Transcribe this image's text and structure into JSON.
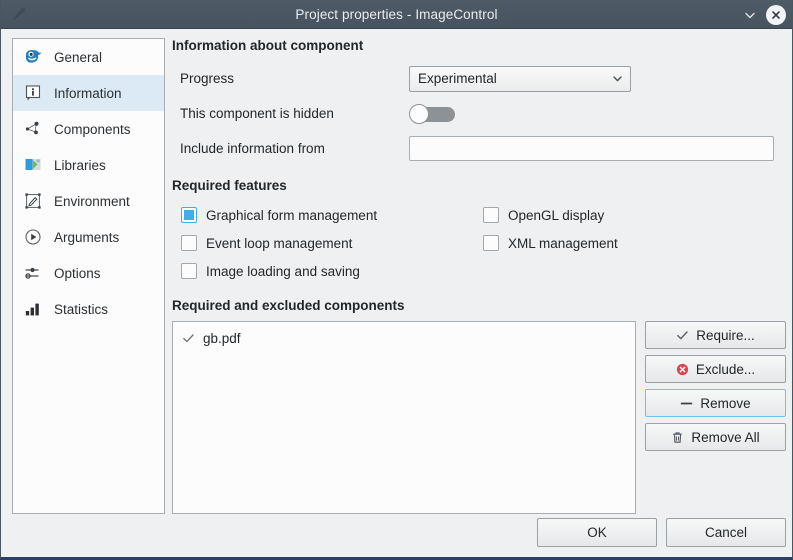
{
  "window": {
    "title": "Project properties - ImageControl",
    "app_icon": "gambas-app-icon",
    "shade_icon": "chevron-down-icon",
    "close_icon": "close-icon"
  },
  "sidebar": {
    "items": [
      {
        "label": "General",
        "icon": "smiley-face-icon",
        "selected": false
      },
      {
        "label": "Information",
        "icon": "info-bubble-icon",
        "selected": true
      },
      {
        "label": "Components",
        "icon": "nodes-network-icon",
        "selected": false
      },
      {
        "label": "Libraries",
        "icon": "library-folder-icon",
        "selected": false
      },
      {
        "label": "Environment",
        "icon": "edit-frame-icon",
        "selected": false
      },
      {
        "label": "Arguments",
        "icon": "play-circle-icon",
        "selected": false
      },
      {
        "label": "Options",
        "icon": "sliders-icon",
        "selected": false
      },
      {
        "label": "Statistics",
        "icon": "bar-chart-icon",
        "selected": false
      }
    ]
  },
  "main": {
    "info_group": {
      "title": "Information about component",
      "progress_label": "Progress",
      "progress_value": "Experimental",
      "progress_chevron": "chevron-down-icon",
      "hidden_label": "This component is hidden",
      "hidden_value": "off",
      "include_label": "Include information from",
      "include_value": "",
      "include_placeholder": ""
    },
    "features_group": {
      "title": "Required features",
      "items": [
        {
          "label": "Graphical form management",
          "checked": true,
          "column": "left"
        },
        {
          "label": "Event loop management",
          "checked": false,
          "column": "left"
        },
        {
          "label": "Image loading and saving",
          "checked": false,
          "column": "left"
        },
        {
          "label": "OpenGL display",
          "checked": false,
          "column": "right"
        },
        {
          "label": "XML management",
          "checked": false,
          "column": "right"
        }
      ]
    },
    "components_group": {
      "title": "Required and excluded components",
      "list_items": [
        {
          "label": "gb.pdf",
          "icon": "check-mark-icon",
          "state": "required"
        }
      ],
      "buttons": [
        {
          "label": "Require...",
          "icon": "check-mark-icon",
          "focused": false
        },
        {
          "label": "Exclude...",
          "icon": "error-circle-icon",
          "focused": false
        },
        {
          "label": "Remove",
          "icon": "minus-icon",
          "focused": true
        },
        {
          "label": "Remove All",
          "icon": "trash-icon",
          "focused": false
        }
      ]
    }
  },
  "footer": {
    "buttons": [
      {
        "label": "OK"
      },
      {
        "label": "Cancel"
      }
    ]
  },
  "colors": {
    "titlebar": "#4b5763",
    "background": "#eff0f1",
    "accent": "#3daee9",
    "selection": "#dbeaf5",
    "focus_border": "#6ec2ee",
    "exclude_red": "#da4453",
    "bottom_border": "#2b4066"
  }
}
